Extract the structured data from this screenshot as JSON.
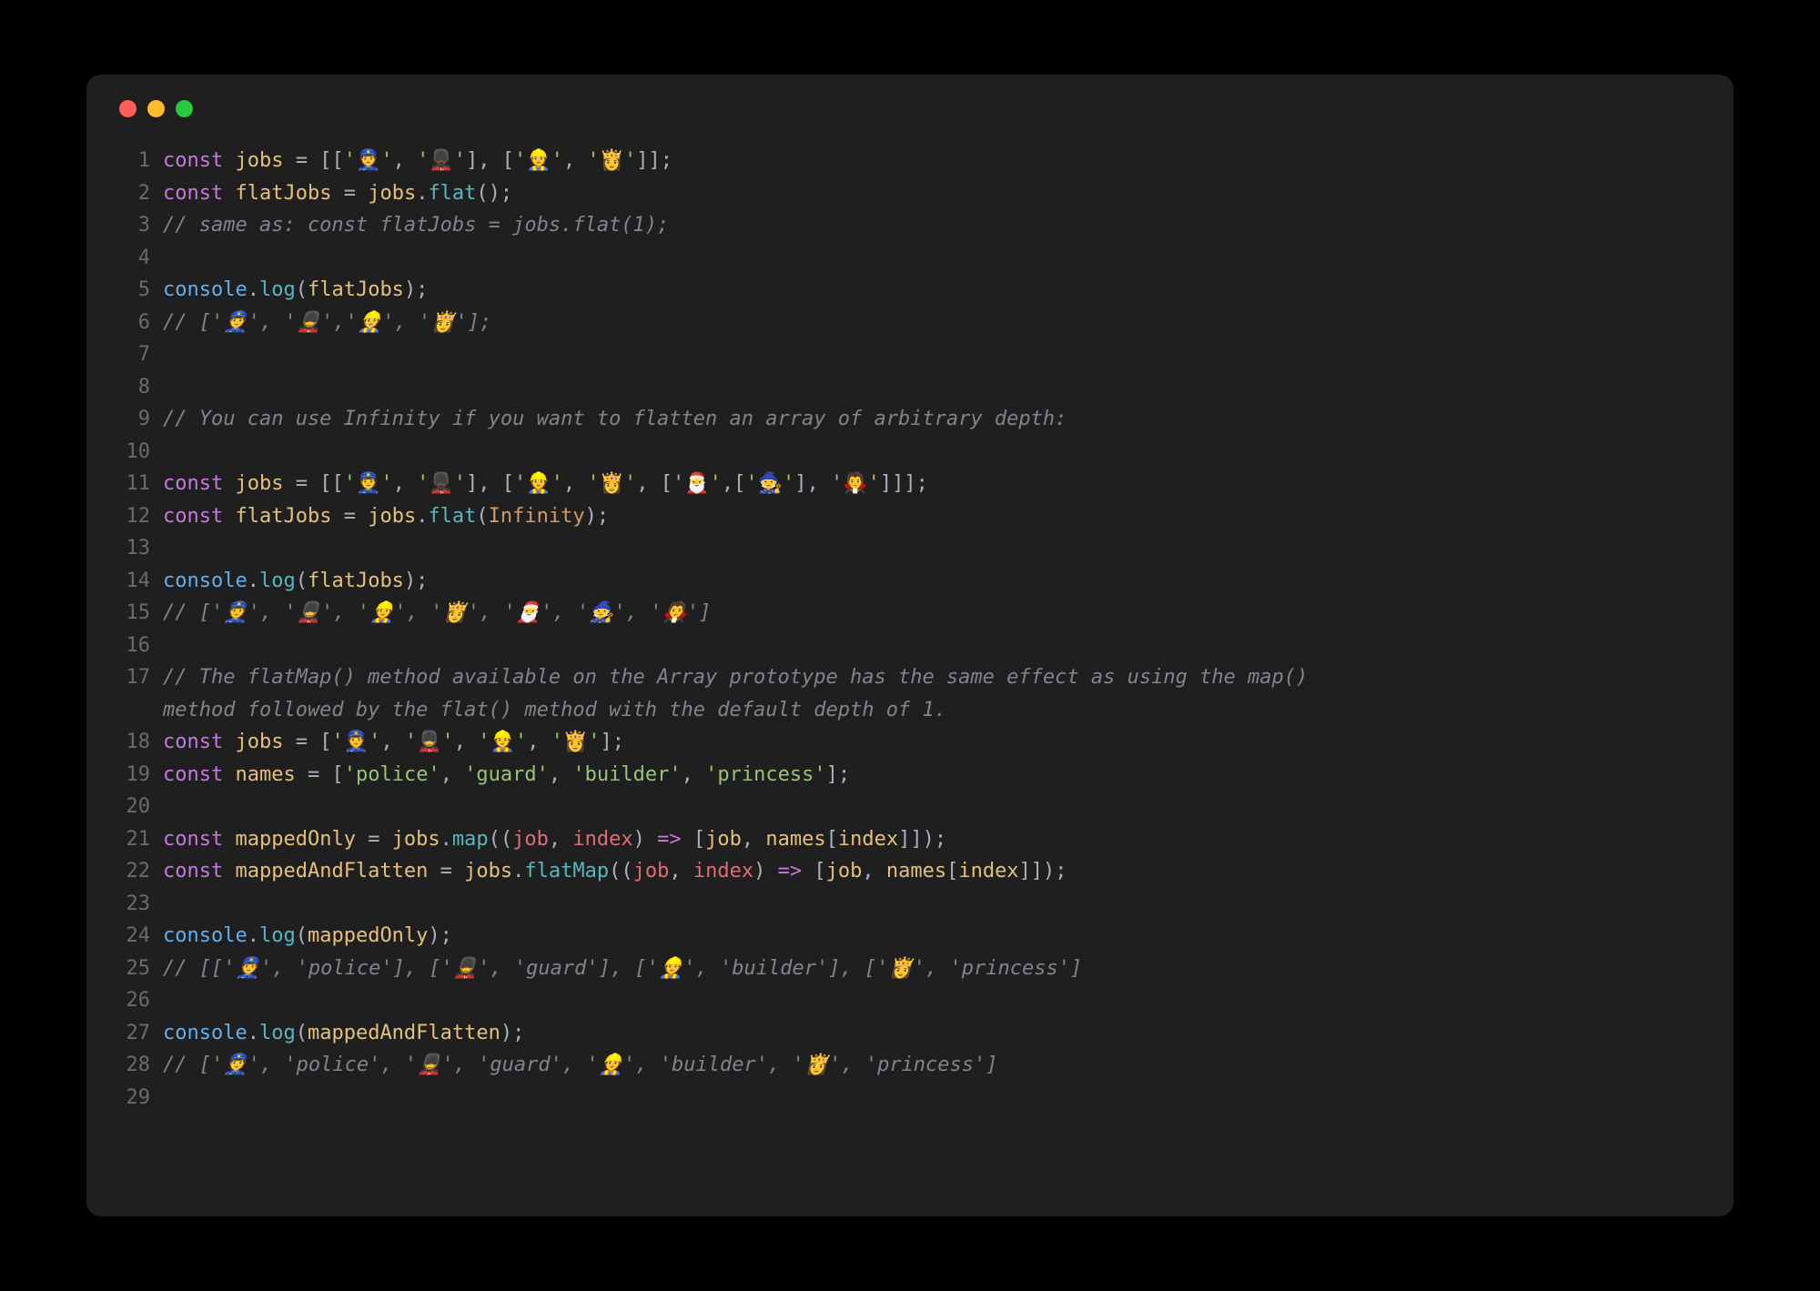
{
  "lines": [
    {
      "n": "1",
      "html": "<span class='kw'>const</span> <span class='var'>jobs</span> <span class='pun'>= [[</span><span class='str'>'👮'</span><span class='pun'>, </span><span class='str'>'💂🏿'</span><span class='pun'>], [</span><span class='str'>'👷'</span><span class='pun'>, </span><span class='str'>'👸'</span><span class='pun'>]];</span>"
    },
    {
      "n": "2",
      "html": "<span class='kw'>const</span> <span class='var'>flatJobs</span> <span class='pun'>= </span><span class='var'>jobs</span><span class='pun'>.</span><span class='fn'>flat</span><span class='pun'>();</span>"
    },
    {
      "n": "3",
      "html": "<span class='comment'>// same as: const flatJobs = jobs.flat(1);</span>"
    },
    {
      "n": "4",
      "html": ""
    },
    {
      "n": "5",
      "html": "<span class='prop'>console</span><span class='pun'>.</span><span class='fn'>log</span><span class='pun'>(</span><span class='var'>flatJobs</span><span class='pun'>);</span>"
    },
    {
      "n": "6",
      "html": "<span class='comment'>// ['👮', '💂','👷', '👸'];</span>"
    },
    {
      "n": "7",
      "html": ""
    },
    {
      "n": "8",
      "html": ""
    },
    {
      "n": "9",
      "html": "<span class='comment'>// You can use Infinity if you want to flatten an array of arbitrary depth:</span>"
    },
    {
      "n": "10",
      "html": ""
    },
    {
      "n": "11",
      "html": "<span class='kw'>const</span> <span class='var'>jobs</span> <span class='pun'>= [[</span><span class='str'>'👮'</span><span class='pun'>, </span><span class='str'>'💂🏿'</span><span class='pun'>], [</span><span class='str'>'👷'</span><span class='pun'>, </span><span class='str'>'👸'</span><span class='pun'>, [</span><span class='str'>'🎅'</span><span class='pun'>,[</span><span class='str'>'🧙'</span><span class='pun'>], </span><span class='str'>'🧛'</span><span class='pun'>]]];</span>"
    },
    {
      "n": "12",
      "html": "<span class='kw'>const</span> <span class='var'>flatJobs</span> <span class='pun'>= </span><span class='var'>jobs</span><span class='pun'>.</span><span class='fn'>flat</span><span class='pun'>(</span><span class='num'>Infinity</span><span class='pun'>);</span>"
    },
    {
      "n": "13",
      "html": ""
    },
    {
      "n": "14",
      "html": "<span class='prop'>console</span><span class='pun'>.</span><span class='fn'>log</span><span class='pun'>(</span><span class='var'>flatJobs</span><span class='pun'>);</span>"
    },
    {
      "n": "15",
      "html": "<span class='comment'>// ['👮', '💂', '👷', '👸', '🎅', '🧙', '🧛']</span>"
    },
    {
      "n": "16",
      "html": ""
    },
    {
      "n": "17",
      "html": "<span class='comment'>// The flatMap() method available on the Array prototype has the same effect as using the map()</span>"
    },
    {
      "n": "",
      "html": "<span class='comment'>method followed by the flat() method with the default depth of 1.</span>",
      "wrap": true
    },
    {
      "n": "18",
      "html": "<span class='kw'>const</span> <span class='var'>jobs</span> <span class='pun'>= [</span><span class='str'>'👮'</span><span class='pun'>, </span><span class='str'>'💂'</span><span class='pun'>, </span><span class='str'>'👷'</span><span class='pun'>, </span><span class='str'>'👸'</span><span class='pun'>];</span>"
    },
    {
      "n": "19",
      "html": "<span class='kw'>const</span> <span class='var'>names</span> <span class='pun'>= [</span><span class='str'>'police'</span><span class='pun'>, </span><span class='str'>'guard'</span><span class='pun'>, </span><span class='str'>'builder'</span><span class='pun'>, </span><span class='str'>'princess'</span><span class='pun'>];</span>"
    },
    {
      "n": "20",
      "html": ""
    },
    {
      "n": "21",
      "html": "<span class='kw'>const</span> <span class='var'>mappedOnly</span> <span class='pun'>= </span><span class='var'>jobs</span><span class='pun'>.</span><span class='fn'>map</span><span class='pun'>((</span><span class='param'>job</span><span class='pun'>, </span><span class='param'>index</span><span class='pun'>) </span><span class='arrow'>=></span><span class='pun'> [</span><span class='var'>job</span><span class='pun'>, </span><span class='var'>names</span><span class='pun'>[</span><span class='var'>index</span><span class='pun'>]]);</span>"
    },
    {
      "n": "22",
      "html": "<span class='kw'>const</span> <span class='var'>mappedAndFlatten</span> <span class='pun'>= </span><span class='var'>jobs</span><span class='pun'>.</span><span class='fn'>flatMap</span><span class='pun'>((</span><span class='param'>job</span><span class='pun'>, </span><span class='param'>index</span><span class='pun'>) </span><span class='arrow'>=></span><span class='pun'> [</span><span class='var'>job</span><span class='pun'>, </span><span class='var'>names</span><span class='pun'>[</span><span class='var'>index</span><span class='pun'>]]);</span>"
    },
    {
      "n": "23",
      "html": ""
    },
    {
      "n": "24",
      "html": "<span class='prop'>console</span><span class='pun'>.</span><span class='fn'>log</span><span class='pun'>(</span><span class='var'>mappedOnly</span><span class='pun'>);</span>"
    },
    {
      "n": "25",
      "html": "<span class='comment'>// [['👮', 'police'], ['💂', 'guard'], ['👷', 'builder'], ['👸', 'princess']</span>"
    },
    {
      "n": "26",
      "html": ""
    },
    {
      "n": "27",
      "html": "<span class='prop'>console</span><span class='pun'>.</span><span class='fn'>log</span><span class='pun'>(</span><span class='var'>mappedAndFlatten</span><span class='pun'>);</span>"
    },
    {
      "n": "28",
      "html": "<span class='comment'>// ['👮', 'police', '💂', 'guard', '👷', 'builder', '👸', 'princess']</span>"
    },
    {
      "n": "29",
      "html": ""
    }
  ]
}
